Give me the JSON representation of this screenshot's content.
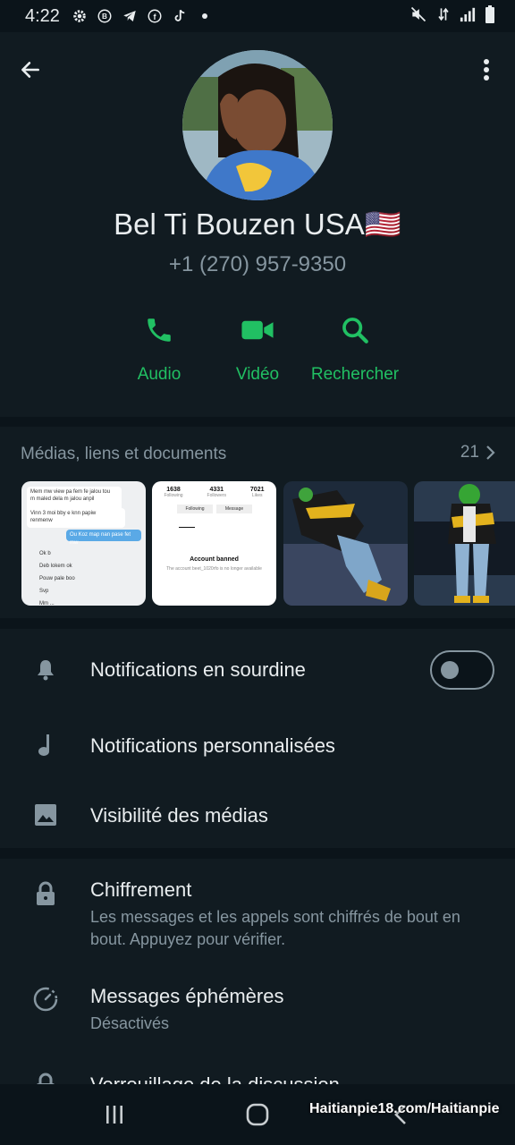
{
  "status_bar": {
    "time": "4:22",
    "left_icons": [
      "settings-icon",
      "b-icon",
      "telegram-icon",
      "facebook-icon",
      "tiktok-icon",
      "dot-icon"
    ],
    "right_icons": [
      "mute-icon",
      "data-icon",
      "signal-icon",
      "battery-icon"
    ]
  },
  "contact": {
    "name": "Bel Ti Bouzen USA🇺🇸",
    "phone": "+1 (270) 957-9350"
  },
  "actions": [
    {
      "label": "Audio",
      "icon": "phone-icon"
    },
    {
      "label": "Vidéo",
      "icon": "video-icon"
    },
    {
      "label": "Rechercher",
      "icon": "search-icon"
    }
  ],
  "media": {
    "title": "Médias, liens et documents",
    "count": "21",
    "thumb1": {
      "lines": [
        "Mem mw view pa fem fe jalou tou",
        "m maled dela m jalou anpil",
        "Vinn 3 moi bby e knn papiw",
        "renmenw",
        "Ou Koz map nan pase fet mw",
        "Ok b",
        "Deb lokem ok",
        "Pouw pale boo",
        "Svp",
        "Mm ..."
      ]
    },
    "thumb2": {
      "stats": [
        {
          "num": "1638",
          "label": "Following"
        },
        {
          "num": "4331",
          "label": "Followers"
        },
        {
          "num": "7021",
          "label": "Likes"
        }
      ],
      "btn1": "Following",
      "btn2": "Message",
      "banned_title": "Account banned",
      "banned_text": "The account beet_1020rfo is no longer available"
    }
  },
  "settings": {
    "mute": {
      "label": "Notifications en sourdine",
      "toggle_on": false
    },
    "custom": {
      "label": "Notifications personnalisées"
    },
    "visibility": {
      "label": "Visibilité des médias"
    },
    "encryption": {
      "label": "Chiffrement",
      "sub": "Les messages et les appels sont chiffrés de bout en bout. Appuyez pour vérifier."
    },
    "ephemeral": {
      "label": "Messages éphémères",
      "sub": "Désactivés"
    },
    "lock": {
      "label": "Verrouillage de la discussion"
    }
  },
  "watermark": "Haitianpie18.com/Haitianpie",
  "colors": {
    "accent": "#21c063",
    "bg": "#0b141a",
    "panel": "#111b21",
    "muted": "#8696a0"
  }
}
